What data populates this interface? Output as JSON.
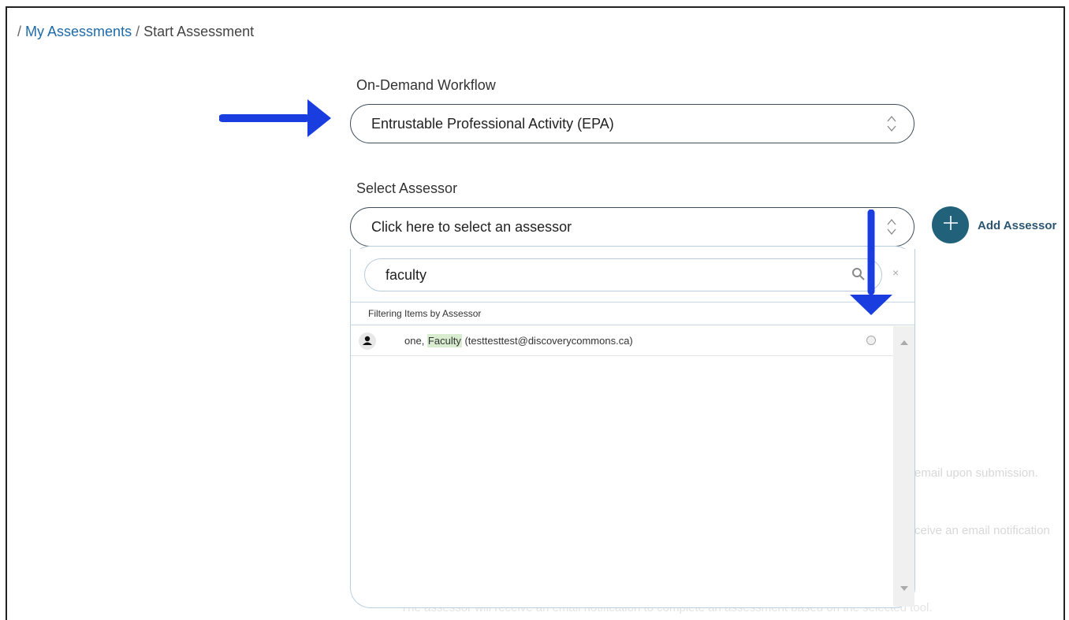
{
  "breadcrumb": {
    "sep1": "/",
    "link": "My Assessments",
    "sep2": "/",
    "current": "Start Assessment"
  },
  "workflow": {
    "label": "On-Demand Workflow",
    "value": "Entrustable Professional Activity (EPA)"
  },
  "assessor": {
    "label": "Select Assessor",
    "placeholder": "Click here to select an assessor",
    "add_label": "Add Assessor"
  },
  "dropdown": {
    "search_value": "faculty",
    "clear": "×",
    "filter_label": "Filtering Items by Assessor",
    "results": [
      {
        "prefix": "one, ",
        "match": "Faculty",
        "suffix": " (testtesttest@discoverycommons.ca)"
      }
    ]
  },
  "background_hints": {
    "line1": "email upon submission.",
    "line2": "ceive an email notification",
    "line3": "The assessor will receive an email notification to complete an assessment based on the selected tool."
  },
  "icons": {
    "user": "user-icon",
    "search": "search-icon",
    "add": "plus-icon",
    "updown": "updown-chevron-icon",
    "arrow_right": "blue-arrow-right",
    "arrow_down": "blue-arrow-down"
  },
  "colors": {
    "link": "#1e6aa8",
    "add_button": "#22617a",
    "arrow": "#1a3de0",
    "highlight": "#d8edd0"
  }
}
